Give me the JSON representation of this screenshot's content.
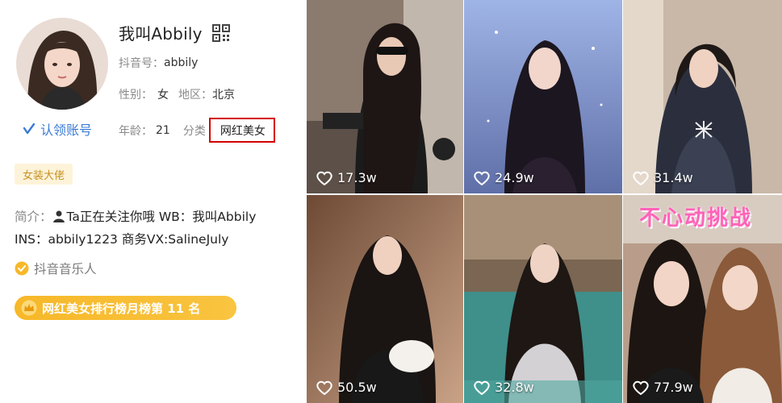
{
  "profile": {
    "name": "我叫Abbily",
    "claim_label": "认领账号",
    "id_label": "抖音号：",
    "id_value": "abbily",
    "gender_label": "性别：",
    "gender_value": "女",
    "region_label": "地区：",
    "region_value": "北京",
    "age_label": "年龄：",
    "age_value": "21",
    "category_label": "分类",
    "category_value": "网红美女",
    "vip_tag": "女装大佬",
    "bio_label": "简介：",
    "bio_line1": "Ta正在关注你哦 WB：我叫Abbily",
    "bio_line2": "INS：abbily1223 商务VX:SalineJuly",
    "musician_label": "抖音音乐人",
    "rank_label": "网红美女排行榜月榜第 11 名"
  },
  "videos": [
    {
      "likes": "17.3w",
      "title": ""
    },
    {
      "likes": "24.9w",
      "title": ""
    },
    {
      "likes": "31.4w",
      "title": ""
    },
    {
      "likes": "50.5w",
      "title": ""
    },
    {
      "likes": "32.8w",
      "title": ""
    },
    {
      "likes": "77.9w",
      "title": "不心动挑战"
    }
  ],
  "colors": {
    "claim_blue": "#3a7bd5",
    "highlight_red": "#d40000",
    "rank_gold": "#f7b829",
    "vip_text": "#c79223",
    "title_pink": "#ff62b8"
  },
  "icons": {
    "qr": "qr-code-icon",
    "claim": "verified-check-icon",
    "musician": "musician-badge-icon",
    "rank": "crown-icon",
    "likes": "heart-icon"
  }
}
